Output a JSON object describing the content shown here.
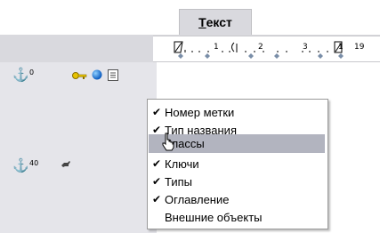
{
  "tab": {
    "label_prefix": "Т",
    "label_rest": "екст"
  },
  "ruler": {
    "numbers": [
      "1",
      "2",
      "3",
      "1",
      "19"
    ]
  },
  "gutter": {
    "rows": [
      {
        "level": "0",
        "icons": [
          "anchor-icon",
          "key-icon",
          "globe-icon",
          "document-icon"
        ]
      },
      {
        "level": "40",
        "icons": [
          "anchor-icon",
          "pin-icon"
        ]
      }
    ]
  },
  "menu": {
    "items": [
      {
        "label": "Номер метки",
        "checked": true
      },
      {
        "label": "Тип названия",
        "checked": true
      },
      {
        "label": "Классы",
        "checked": false,
        "hover": true
      },
      {
        "label": "Ключи",
        "checked": true
      },
      {
        "label": "Типы",
        "checked": true
      },
      {
        "label": "Оглавление",
        "checked": true
      },
      {
        "label": "Внешние объекты",
        "checked": false
      }
    ]
  },
  "colors": {
    "menu_hover": "#b2b4bf",
    "gutter": "#e5e5ea",
    "anchor": "#1a4aa0"
  }
}
